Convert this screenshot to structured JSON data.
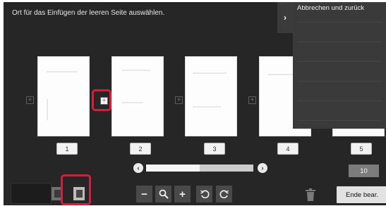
{
  "instruction": "Ort für das Einfügen der leeren Seite auswählen.",
  "side_menu": {
    "toggle_glyph": "›",
    "cancel_label": "Abbrechen und zurück"
  },
  "pages": [
    {
      "label": "1"
    },
    {
      "label": "2"
    },
    {
      "label": "3"
    },
    {
      "label": "4"
    },
    {
      "label": "5"
    }
  ],
  "insert_marker_glyph": "+",
  "selected_insert_position": "between page 1 and page 2",
  "scrollbar": {
    "left_glyph": "‹",
    "right_glyph": "›",
    "thumb_fraction": 0.5
  },
  "page_count": "10",
  "toolbar": {
    "zoom_out_glyph": "−",
    "zoom_in_glyph": "+"
  },
  "end_button_label": "Ende bear.",
  "icons": [
    "thumbnail-view-icon",
    "page-view-icon",
    "zoom-out-icon",
    "magnifier-icon",
    "zoom-in-icon",
    "rotate-left-icon",
    "rotate-right-icon",
    "trash-icon"
  ],
  "colors": {
    "panel_background": "#262626",
    "highlight": "#d51e3c",
    "menu_background": "#3a3a3a"
  }
}
